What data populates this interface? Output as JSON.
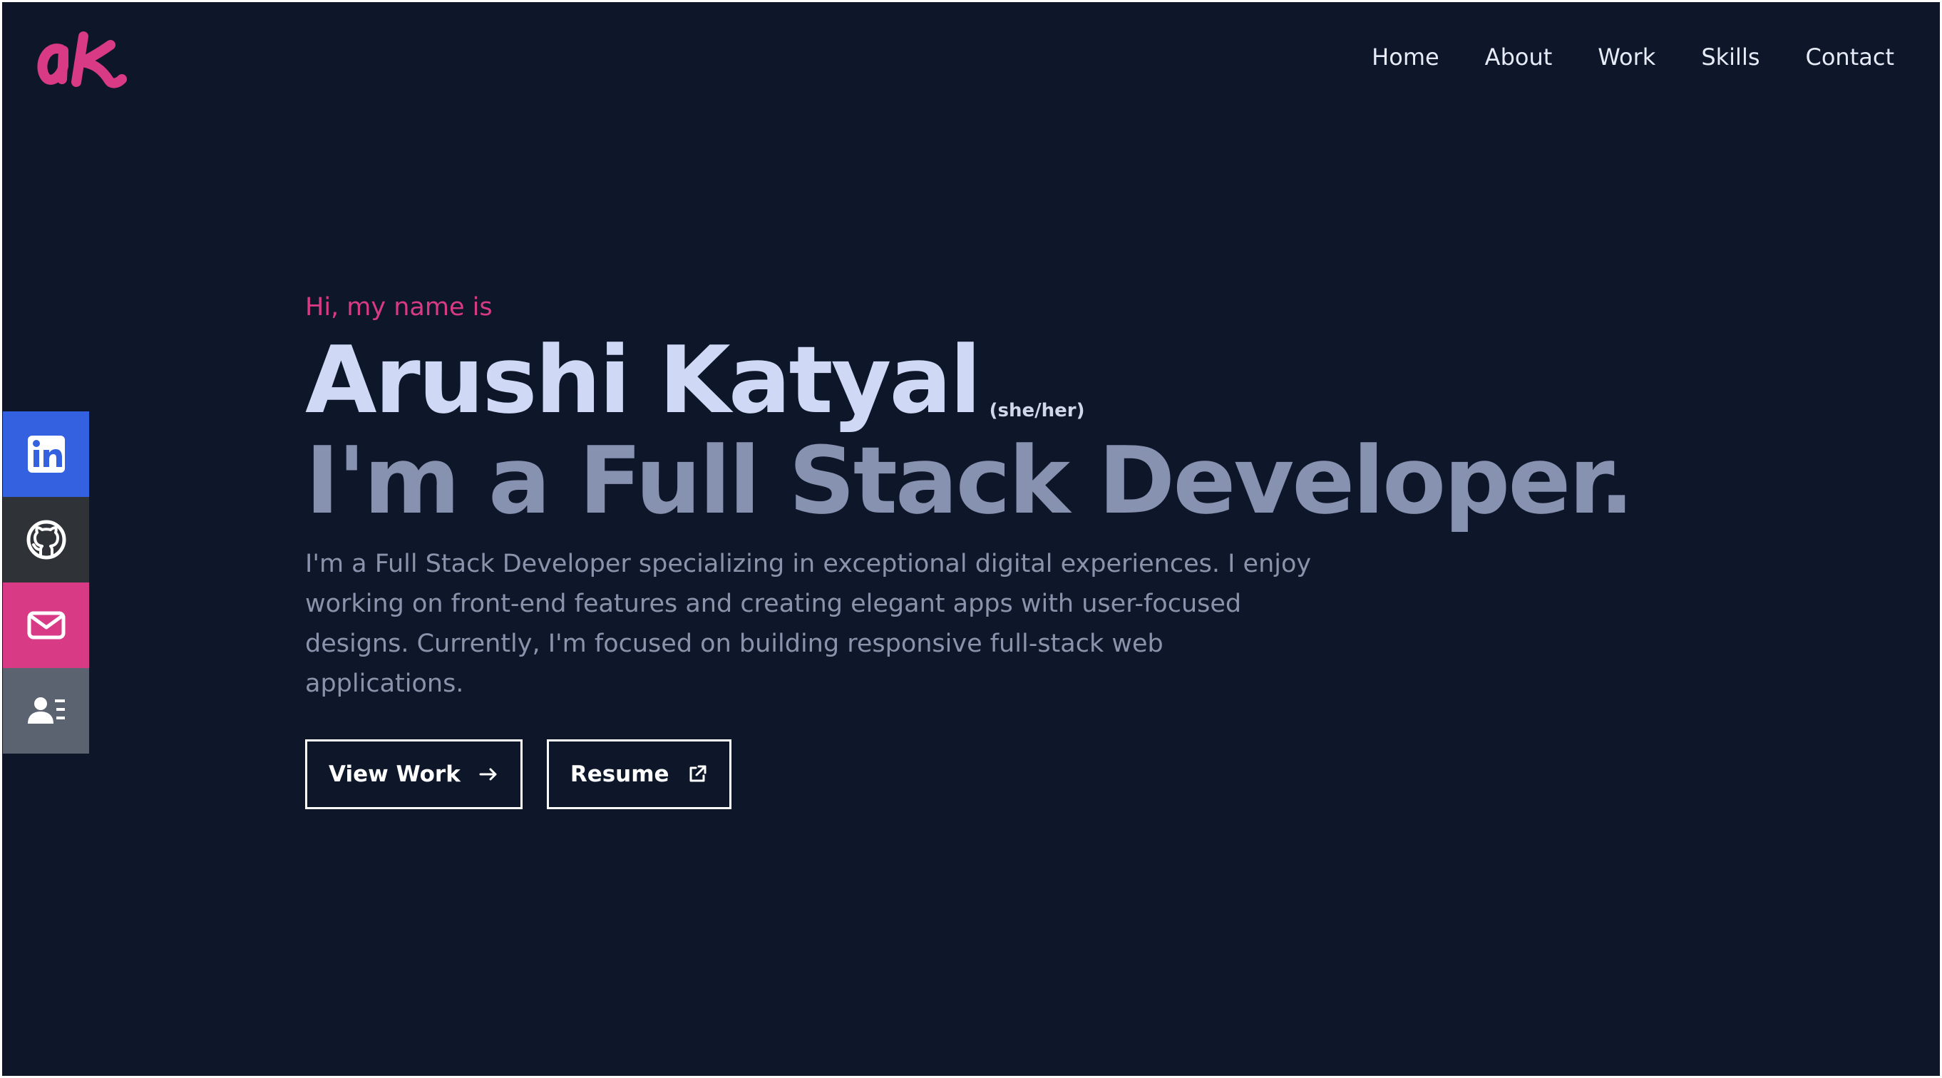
{
  "logo": {
    "text": "ak",
    "color": "#d83a86"
  },
  "nav": {
    "items": [
      {
        "label": "Home"
      },
      {
        "label": "About"
      },
      {
        "label": "Work"
      },
      {
        "label": "Skills"
      },
      {
        "label": "Contact"
      }
    ]
  },
  "social": [
    {
      "name": "linkedin-icon",
      "color": "#3461e0"
    },
    {
      "name": "github-icon",
      "color": "#2f3237"
    },
    {
      "name": "mail-icon",
      "color": "#d83a86"
    },
    {
      "name": "contact-card-icon",
      "color": "#5b6371"
    }
  ],
  "hero": {
    "greeting": "Hi, my name is",
    "name": "Arushi Katyal",
    "pronouns": "(she/her)",
    "role": "I'm a Full Stack Developer.",
    "bio": "I'm a Full Stack Developer specializing in exceptional digital experiences. I enjoy working on front-end features and creating elegant apps with user-focused designs. Currently, I'm focused on building responsive full-stack web applications.",
    "buttons": {
      "view_work": "View Work",
      "resume": "Resume"
    }
  },
  "colors": {
    "background": "#0e1729",
    "accent": "#d83a86",
    "name_color": "#cfd8f5",
    "role_color": "#8791b0",
    "bio_color": "#8a93ab"
  }
}
